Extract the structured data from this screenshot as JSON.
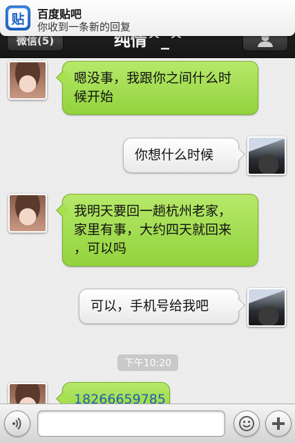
{
  "notification": {
    "app_name": "百度贴吧",
    "message": "你收到一条新的回复",
    "icon_label": "贴"
  },
  "navbar": {
    "back_label": "微信(5)",
    "title": "纯情^_^"
  },
  "messages": [
    {
      "side": "left",
      "lines": [
        "嗯没事，我跟你之间什么时",
        "候开始"
      ]
    },
    {
      "side": "right",
      "lines": [
        "你想什么时候"
      ]
    },
    {
      "side": "left",
      "lines": [
        "我明天要回一趟杭州老家，",
        "家里有事，大约四天就回来",
        "，可以吗"
      ]
    },
    {
      "side": "right",
      "lines": [
        "可以，手机号给我吧"
      ]
    },
    {
      "side": "left",
      "lines": [
        "18266659785"
      ]
    }
  ],
  "timestamp": "下午10:20",
  "input_bar": {
    "placeholder": ""
  },
  "colors": {
    "green_bubble": "#a8e052",
    "navbar": "#1f1f1f",
    "timestamp_badge": "#c9c9c9"
  }
}
